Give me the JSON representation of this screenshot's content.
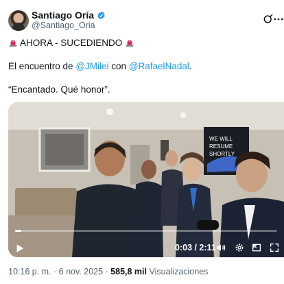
{
  "header": {
    "name": "Santiago Oría",
    "handle": "@Santiago_Oria"
  },
  "tweet": {
    "line1": "AHORA - SUCEDIENDO",
    "line2_prefix": "El encuentro de ",
    "mention1": "@JMilei",
    "line2_mid": " con ",
    "mention2": "@RafaelNadal",
    "line2_suffix": ".",
    "line3": "“Encantado. Qué honor”."
  },
  "media": {
    "screen_text": [
      "WE WILL",
      "RESUME",
      "SHORTLY"
    ],
    "time": "0:03 / 2:11",
    "progress_fraction": 0.023
  },
  "meta": {
    "time": "10:16 p. m.",
    "separator1": " · ",
    "date": "6 nov. 2025",
    "separator2": " · ",
    "views": "585,8 mil",
    "views_label": " Visualizaciones"
  },
  "icons": {
    "verified": "verified-badge-icon",
    "grok": "grok-icon",
    "more": "more-icon",
    "siren": "siren-icon"
  },
  "colors": {
    "accent": "#1d9bf0",
    "text": "#0f1419",
    "muted": "#536471"
  }
}
